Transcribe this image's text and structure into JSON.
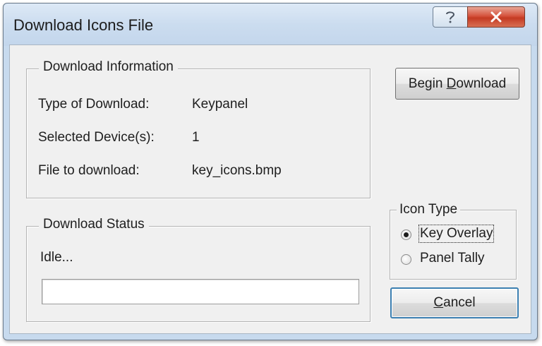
{
  "window": {
    "title": "Download Icons File",
    "help_icon": "question-mark-icon",
    "close_icon": "close-x-icon"
  },
  "download_info": {
    "group_title": "Download Information",
    "rows": [
      {
        "label": "Type of Download:",
        "value": "Keypanel"
      },
      {
        "label": "Selected Device(s):",
        "value": "1"
      },
      {
        "label": "File to download:",
        "value": "key_icons.bmp"
      }
    ]
  },
  "download_status": {
    "group_title": "Download Status",
    "status_text": "Idle...",
    "progress": 0
  },
  "begin_button": {
    "label_pre": "Begin ",
    "label_mnemonic": "D",
    "label_post": "ownload"
  },
  "icon_type": {
    "group_title": "Icon Type",
    "options": [
      {
        "label": "Key Overlay",
        "selected": true
      },
      {
        "label": "Panel Tally",
        "selected": false
      }
    ]
  },
  "cancel_button": {
    "label_mnemonic": "C",
    "label_post": "ancel"
  },
  "colors": {
    "title_bar": "#c7daee",
    "dialog_face": "#f0f0f0",
    "close_button": "#c94a33",
    "default_button_border": "#3c7fb1"
  }
}
